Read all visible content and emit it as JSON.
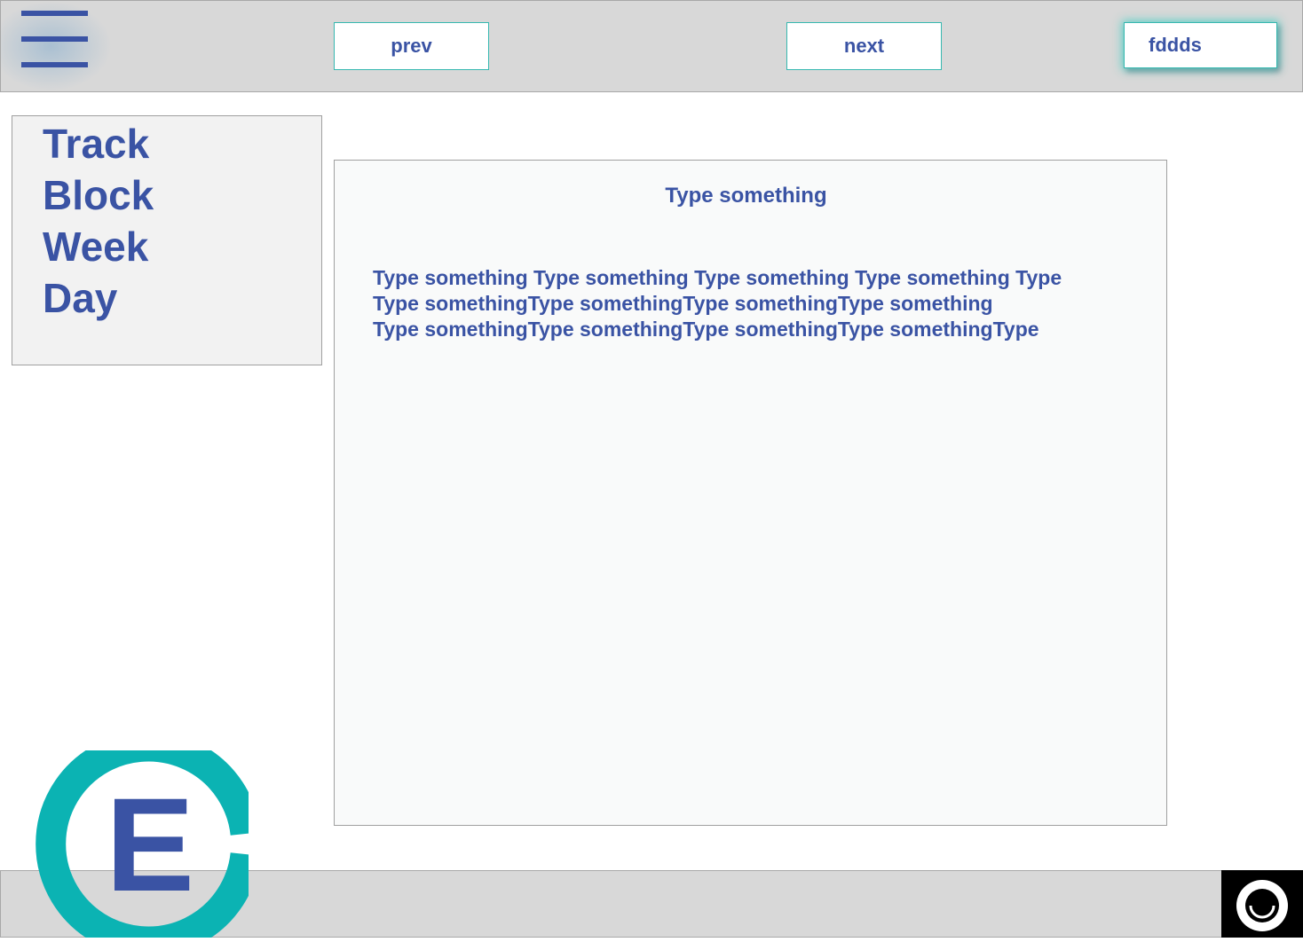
{
  "header": {
    "menu_icon": "hamburger-menu-icon",
    "prev_label": "prev",
    "next_label": "next",
    "user_label": "fddds"
  },
  "sidebar": {
    "items": [
      {
        "label": "Track"
      },
      {
        "label": "Block"
      },
      {
        "label": "Week"
      },
      {
        "label": "Day"
      }
    ]
  },
  "content": {
    "title": "Type something",
    "lines": [
      "Type something Type something Type something Type something Type",
      "Type somethingType somethingType somethingType something",
      "Type somethingType somethingType somethingType somethingType"
    ]
  },
  "logo": {
    "letter": "E",
    "ring_color": "#0bb3b3",
    "letter_color": "#3a53a4"
  },
  "footer": {
    "corner_icon": "circle-smile-icon"
  },
  "colors": {
    "accent": "#3a53a4",
    "teal": "#0bb3b3",
    "bar_bg": "#d8d8d8"
  }
}
